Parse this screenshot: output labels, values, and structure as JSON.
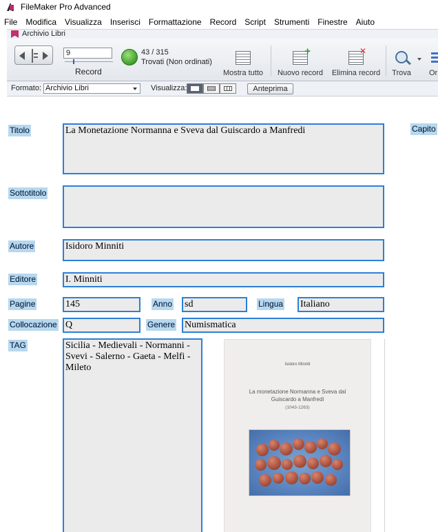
{
  "app": {
    "title": "FileMaker Pro Advanced"
  },
  "menu": [
    "File",
    "Modifica",
    "Visualizza",
    "Inserisci",
    "Formattazione",
    "Record",
    "Script",
    "Strumenti",
    "Finestre",
    "Aiuto"
  ],
  "window": {
    "tab_title": "Archivio Libri"
  },
  "toolbar": {
    "record_number": "9",
    "record_label": "Record",
    "found_count": "43 / 315",
    "found_status": "Trovati (Non ordinati)",
    "show_all": "Mostra tutto",
    "new_record": "Nuovo record",
    "delete_record": "Elimina record",
    "find": "Trova",
    "sort": "Or"
  },
  "layoutbar": {
    "format_label": "Formato:",
    "layout_name": "Archivio Libri",
    "view_label": "Visualizza:",
    "preview": "Anteprima"
  },
  "record": {
    "titolo_label": "Titolo",
    "titolo": "La Monetazione Normanna e Sveva dal Guiscardo a Manfredi",
    "sottotitolo_label": "Sottotitolo",
    "sottotitolo": "",
    "autore_label": "Autore",
    "autore": "Isidoro Minniti",
    "editore_label": "Editore",
    "editore": "I. Minniti",
    "pagine_label": "Pagine",
    "pagine": "145",
    "anno_label": "Anno",
    "anno": "sd",
    "lingua_label": "Lingua",
    "lingua": "Italiano",
    "collocazione_label": "Collocazione",
    "collocazione": "Q",
    "genere_label": "Genere",
    "genere": "Numismatica",
    "tag_label": "TAG",
    "tag": "Sicilia - Medievali - Normanni - Svevi - Salerno - Gaeta - Melfi - Mileto",
    "capitolo_label": "Capito"
  },
  "cover": {
    "author": "Isidoro Minniti",
    "title": "La monetazione Normanna e Sveva dal Guiscardo a Manfredi",
    "dates": "(1043-1263)"
  },
  "colors": {
    "label_bg": "#b7d8ee",
    "field_bg": "#ebebeb",
    "field_border": "#2c7fd6"
  }
}
